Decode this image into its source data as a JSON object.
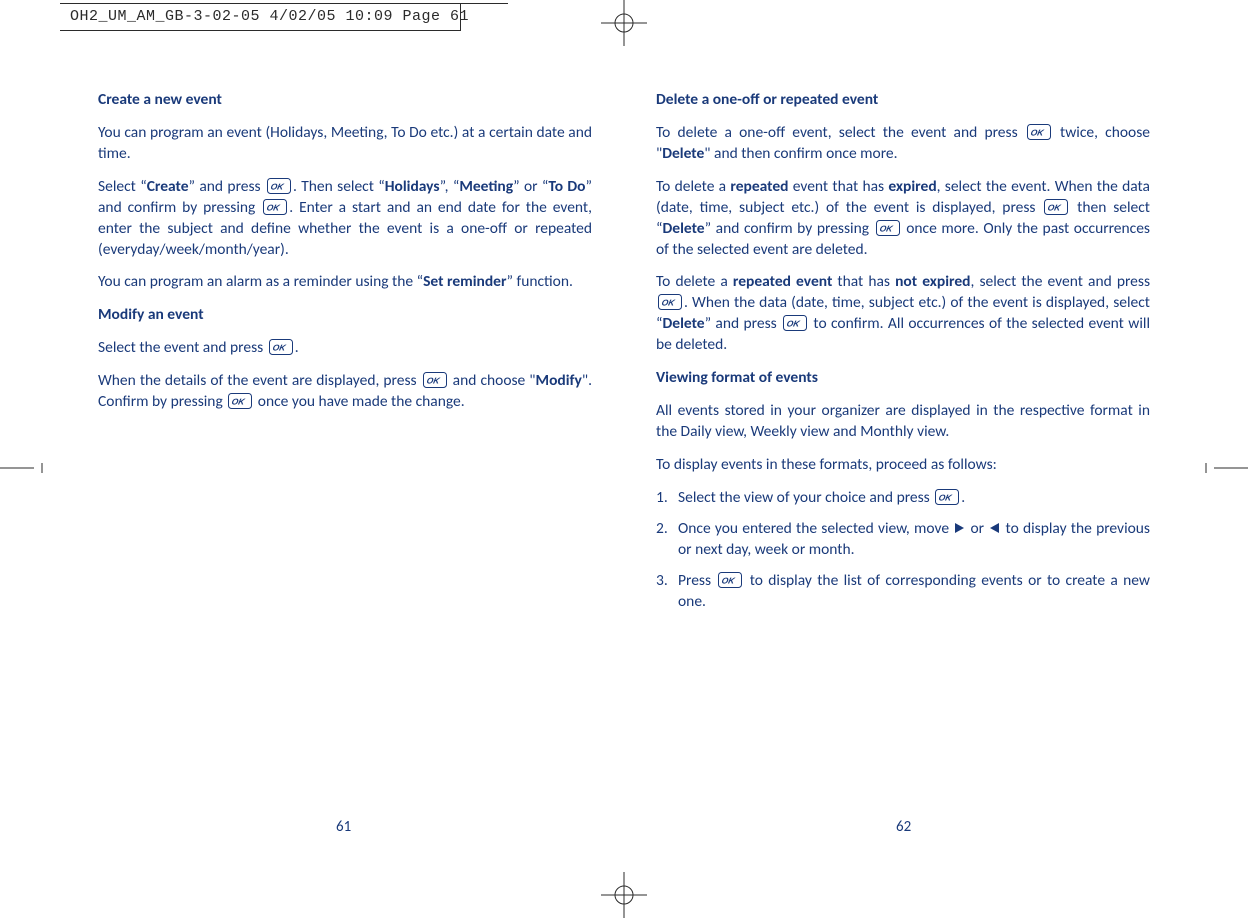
{
  "slug": "OH2_UM_AM_GB-3-02-05   4/02/05  10:09  Page 61",
  "left": {
    "h_create": "Create a new event",
    "p1": "You can program an event (Holidays, Meeting, To Do etc.) at a certain date and time.",
    "p2a": "Select “",
    "p2b": "” and press ",
    "p2c": ". Then select “",
    "p2d": "”, “",
    "p2e": "” or “",
    "p2f": "” and confirm by pressing ",
    "p2g": ". Enter a start and an end date for the event, enter the subject and define whether the event is a one-off or repeated (everyday/week/month/year).",
    "w_create": "Create",
    "w_holidays": "Holidays",
    "w_meeting": "Meeting",
    "w_todo": "To Do",
    "p3a": "You can program an alarm as a reminder using the “",
    "p3b": "” function.",
    "w_setreminder": "Set reminder",
    "h_modify": "Modify an event",
    "p4a": "Select the event and press ",
    "p4b": ".",
    "p5a": "When the details of the event are displayed, press ",
    "p5b": " and choose \"",
    "p5c": "\". Confirm by pressing ",
    "p5d": " once you have made the change.",
    "w_modify": "Modify"
  },
  "right": {
    "h_delete": "Delete a one-off or repeated event",
    "p1a": "To delete a one-off event, select the event and press ",
    "p1b": " twice, choose \"",
    "p1c": "\" and then confirm once more.",
    "w_delete": "Delete",
    "p2a": "To delete a ",
    "p2b": " event that has ",
    "p2c": ", select the event. When the data (date, time, subject etc.) of the event is displayed, press ",
    "p2d": " then select “",
    "p2e": "” and confirm by pressing ",
    "p2f": " once more. Only the past occurrences of the selected event are deleted.",
    "w_repeated": "repeated",
    "w_expired": "expired",
    "p3a": "To delete a ",
    "p3b": " that has ",
    "p3c": ", select the event and press ",
    "p3d": ". When the data (date, time, subject etc.) of the event is displayed, select “",
    "p3e": "” and press ",
    "p3f": " to confirm. All occurrences of the selected event will be deleted.",
    "w_repeated_event": "repeated event",
    "w_not_expired": "not expired",
    "h_view": "Viewing format of events",
    "p4": "All events stored in your organizer are displayed in the respective format in the Daily view, Weekly view and Monthly view.",
    "p5": "To display events in these formats, proceed as follows:",
    "s1a": "Select the view of your choice and press ",
    "s1b": ".",
    "s2a": "Once you entered the selected view, move ",
    "s2b": " or ",
    "s2c": " to display the previous or next day, week or month.",
    "s3a": "Press ",
    "s3b": " to display the list of corresponding events or to create a new one."
  },
  "pagenum_left": "61",
  "pagenum_right": "62"
}
